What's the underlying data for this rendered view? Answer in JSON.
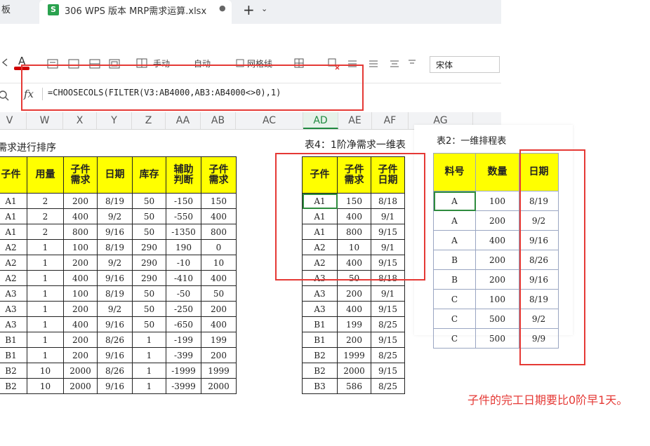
{
  "tabs": {
    "left_label": "板",
    "active_icon": "S",
    "active_title": "306 WPS 版本 MRP需求运算.xlsx",
    "modified_dot": "●",
    "plus": "+",
    "chevron": "⌄"
  },
  "toolbar": {
    "manual": "手动",
    "auto": "自动",
    "gridlines": "网格线",
    "font_name": "宋体"
  },
  "formula_bar": {
    "fx": "fx",
    "formula": "=CHOOSECOLS(FILTER(V3:AB4000,AB3:AB4000<>0),1)"
  },
  "columns": [
    {
      "label": "V"
    },
    {
      "label": "W"
    },
    {
      "label": "X"
    },
    {
      "label": "Y"
    },
    {
      "label": "Z"
    },
    {
      "label": "AA"
    },
    {
      "label": "AB"
    },
    {
      "label": "AC"
    },
    {
      "label": "AD"
    },
    {
      "label": "AE"
    },
    {
      "label": "AF"
    },
    {
      "label": "AG"
    }
  ],
  "table1": {
    "title": "需求进行排序",
    "headers": [
      "子件",
      "用量",
      "子件\n需求",
      "日期",
      "库存",
      "辅助\n判断",
      "子件\n需求"
    ],
    "rows": [
      [
        "A1",
        "2",
        "200",
        "8/19",
        "50",
        "-150",
        "150"
      ],
      [
        "A1",
        "2",
        "400",
        "9/2",
        "50",
        "-550",
        "400"
      ],
      [
        "A1",
        "2",
        "800",
        "9/16",
        "50",
        "-1350",
        "800"
      ],
      [
        "A2",
        "1",
        "100",
        "8/19",
        "290",
        "190",
        "0"
      ],
      [
        "A2",
        "1",
        "200",
        "9/2",
        "290",
        "-10",
        "10"
      ],
      [
        "A2",
        "1",
        "400",
        "9/16",
        "290",
        "-410",
        "400"
      ],
      [
        "A3",
        "1",
        "100",
        "8/19",
        "50",
        "-50",
        "50"
      ],
      [
        "A3",
        "1",
        "200",
        "9/2",
        "50",
        "-250",
        "200"
      ],
      [
        "A3",
        "1",
        "400",
        "9/16",
        "50",
        "-650",
        "400"
      ],
      [
        "B1",
        "1",
        "200",
        "8/26",
        "1",
        "-199",
        "199"
      ],
      [
        "B1",
        "1",
        "200",
        "9/16",
        "1",
        "-399",
        "200"
      ],
      [
        "B2",
        "10",
        "2000",
        "8/26",
        "1",
        "-1999",
        "1999"
      ],
      [
        "B2",
        "10",
        "2000",
        "9/16",
        "1",
        "-3999",
        "2000"
      ]
    ]
  },
  "table4": {
    "title": "表4：1阶净需求一维表",
    "headers": [
      "子件",
      "子件\n需求",
      "子件\n日期"
    ],
    "rows": [
      [
        "A1",
        "150",
        "8/18"
      ],
      [
        "A1",
        "400",
        "9/1"
      ],
      [
        "A1",
        "800",
        "9/15"
      ],
      [
        "A2",
        "10",
        "9/1"
      ],
      [
        "A2",
        "400",
        "9/15"
      ],
      [
        "A3",
        "50",
        "8/18"
      ],
      [
        "A3",
        "200",
        "9/1"
      ],
      [
        "A3",
        "400",
        "9/15"
      ],
      [
        "B1",
        "199",
        "8/25"
      ],
      [
        "B1",
        "200",
        "9/15"
      ],
      [
        "B2",
        "1999",
        "8/25"
      ],
      [
        "B2",
        "2000",
        "9/15"
      ],
      [
        "B3",
        "586",
        "8/25"
      ]
    ]
  },
  "table2": {
    "title": "表2：一维排程表",
    "headers": [
      "料号",
      "数量",
      "日期"
    ],
    "rows": [
      [
        "A",
        "100",
        "8/19"
      ],
      [
        "A",
        "200",
        "9/2"
      ],
      [
        "A",
        "400",
        "9/16"
      ],
      [
        "B",
        "200",
        "8/26"
      ],
      [
        "B",
        "200",
        "9/16"
      ],
      [
        "C",
        "100",
        "8/19"
      ],
      [
        "C",
        "500",
        "9/2"
      ],
      [
        "C",
        "500",
        "9/9"
      ]
    ]
  },
  "note": "子件的完工日期要比0阶早1天。",
  "colors": {
    "header_fill": "#ffff00",
    "annotation": "#e53935",
    "active_green": "#1f8a3f"
  }
}
